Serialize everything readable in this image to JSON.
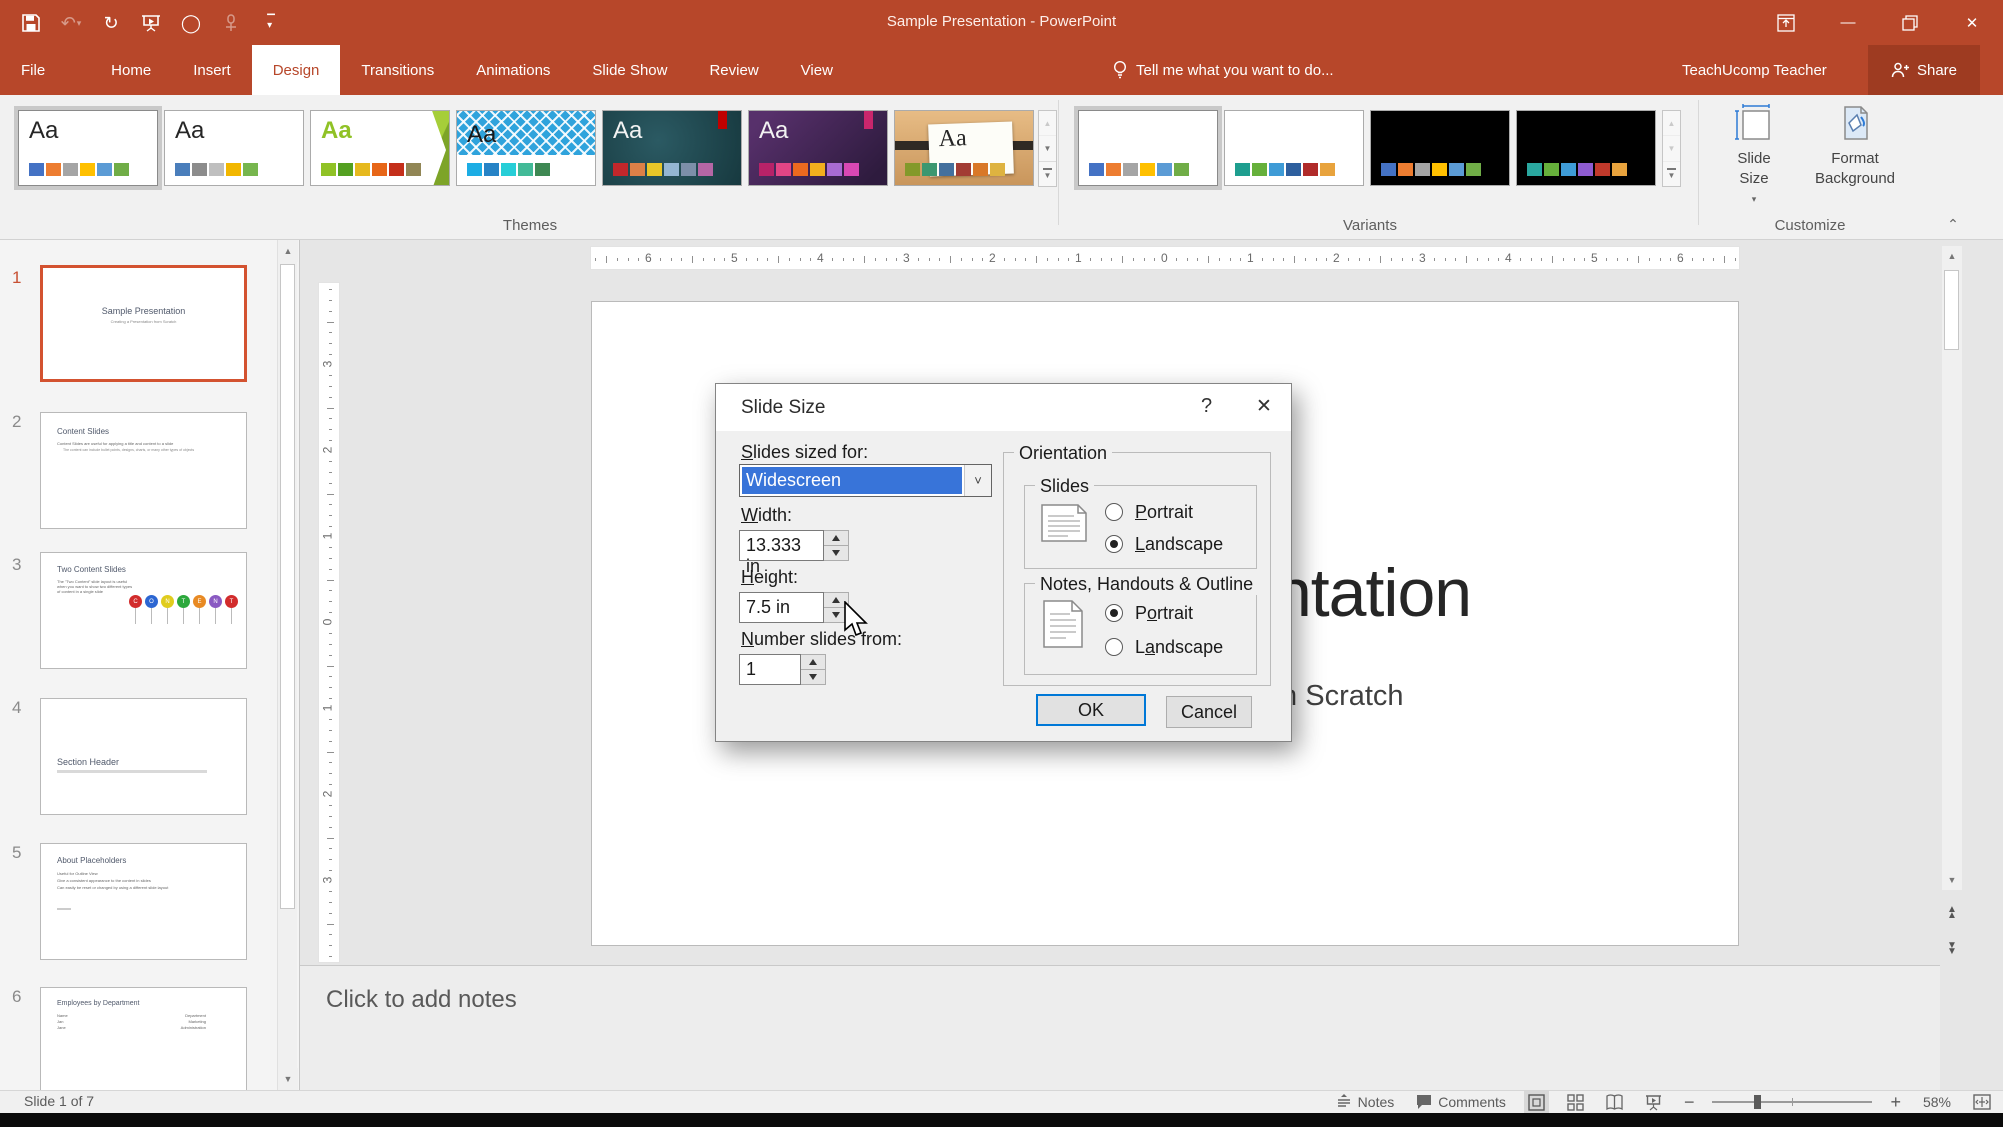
{
  "titlebar": {
    "title": "Sample Presentation - PowerPoint"
  },
  "tabs": [
    {
      "label": "File"
    },
    {
      "label": "Home"
    },
    {
      "label": "Insert"
    },
    {
      "label": "Design",
      "active": true
    },
    {
      "label": "Transitions"
    },
    {
      "label": "Animations"
    },
    {
      "label": "Slide Show"
    },
    {
      "label": "Review"
    },
    {
      "label": "View"
    }
  ],
  "tell_me": "Tell me what you want to do...",
  "account": "TeachUcomp Teacher",
  "share_label": "Share",
  "groups": {
    "themes": "Themes",
    "variants": "Variants",
    "customize": "Customize"
  },
  "customize": {
    "slide_size_label": "Slide Size",
    "format_background_label": "Format Background"
  },
  "themes": [
    {
      "letters": "Aa",
      "colors": [
        "#4472C4",
        "#ED7D31",
        "#A5A5A5",
        "#FFC000",
        "#5B9BD5",
        "#70AD47"
      ]
    },
    {
      "letters": "Aa",
      "colors": [
        "#4A7EBB",
        "#8C8C8C",
        "#BFBFBF",
        "#F2B700",
        "#77B64E"
      ]
    },
    {
      "letters": "Aa",
      "colors": [
        "#90C226",
        "#54A021",
        "#E6B91E",
        "#E76618",
        "#C42F1A",
        "#918655"
      ]
    },
    {
      "letters": "Aa",
      "colors": [
        "#1CADE4",
        "#2683C6",
        "#27CED7",
        "#42BA97",
        "#3E8853"
      ]
    },
    {
      "letters": "Aa",
      "colors": [
        "#C3272B",
        "#DD8047",
        "#E8C628",
        "#94B6D2",
        "#7D8FA9",
        "#B566A5"
      ]
    },
    {
      "letters": "Aa",
      "colors": [
        "#B72268",
        "#E34585",
        "#EC6A1F",
        "#F2AF1D",
        "#A86BD2",
        "#D948B4"
      ]
    },
    {
      "letters": "Aa",
      "colors": [
        "#83992A",
        "#3C9770",
        "#44709D",
        "#A23C33",
        "#D97828",
        "#DEB340"
      ]
    }
  ],
  "variants": [
    {
      "colors": [
        "#4472C4",
        "#ED7D31",
        "#A5A5A5",
        "#FFC000",
        "#5B9BD5",
        "#70AD47"
      ]
    },
    {
      "colors": [
        "#1E9E8F",
        "#66B03B",
        "#3E9BD6",
        "#2E5F9E",
        "#B02B2A",
        "#E8A33D"
      ]
    },
    {
      "colors": [
        "#4472C4",
        "#ED7D31",
        "#A5A5A5",
        "#FFC000",
        "#5B9BD5",
        "#70AD47"
      ],
      "dark": true
    },
    {
      "colors": [
        "#2AA8A0",
        "#66B03B",
        "#3E9BD6",
        "#8E5BD0",
        "#C0392B",
        "#E8A33D"
      ],
      "dark": true
    }
  ],
  "thumbnails": [
    {
      "num": "1",
      "title": "Sample Presentation",
      "subtitle": "Creating a Presentation from Scratch"
    },
    {
      "num": "2",
      "title": "Content Slides",
      "bullets": [
        "Content Slides are useful for applying a title and content to a slide",
        "The content can include bullet points, designs, charts, or many other types of objects"
      ]
    },
    {
      "num": "3",
      "title": "Two Content Slides",
      "bullets": [
        "The \"Two Content\" slide layout is useful when you want to show two different types of content in a single slide"
      ],
      "balloons": [
        {
          "letter": "C",
          "color": "#D22C2C"
        },
        {
          "letter": "O",
          "color": "#2C66D2"
        },
        {
          "letter": "N",
          "color": "#E0CC1E"
        },
        {
          "letter": "T",
          "color": "#2CA83C"
        },
        {
          "letter": "E",
          "color": "#E88A24"
        },
        {
          "letter": "N",
          "color": "#8A5AC2"
        },
        {
          "letter": "T",
          "color": "#D22C2C"
        }
      ]
    },
    {
      "num": "4",
      "title": "Section Header"
    },
    {
      "num": "5",
      "title": "About Placeholders",
      "bullets": [
        "Useful for Outline View",
        "Give a consistent appearance to the content in slides",
        "Can easily be reset or changed by using a different slide layout"
      ]
    },
    {
      "num": "6",
      "title": "Employees by Department",
      "table": {
        "col1": [
          "Name",
          "Jan",
          "Jane"
        ],
        "col2": [
          "Department",
          "Marketing",
          "Administration"
        ]
      }
    }
  ],
  "slide": {
    "title": "Sample Presentation",
    "subtitle": "Creating a Presentation from Scratch"
  },
  "notes_placeholder": "Click to add notes",
  "statusbar": {
    "counter": "Slide 1 of 7",
    "notes": "Notes",
    "comments": "Comments",
    "zoom_level": "58%"
  },
  "rulers": {
    "h": [
      "6",
      "5",
      "4",
      "3",
      "2",
      "1",
      "0",
      "1",
      "2",
      "3",
      "4",
      "5",
      "6"
    ],
    "v": [
      "3",
      "2",
      "1",
      "0",
      "1",
      "2",
      "3"
    ]
  },
  "dialog": {
    "title": "Slide Size",
    "help": "?",
    "close": "✕",
    "sized_for_label": {
      "text": "Slides sized for:",
      "u": 0
    },
    "sized_for_value": "Widescreen",
    "width_label": {
      "text": "Width:",
      "u": 0
    },
    "width_value": "13.333 in",
    "height_label": {
      "text": "Height:",
      "u": 0
    },
    "height_value": "7.5 in",
    "number_label": {
      "text": "Number slides from:",
      "u": 0
    },
    "number_value": "1",
    "orientation_label": "Orientation",
    "slides_group_label": "Slides",
    "notes_group_label": "Notes, Handouts & Outline",
    "slides_portrait": {
      "text": "Portrait",
      "u": 0
    },
    "slides_landscape": {
      "text": "Landscape",
      "u": 0
    },
    "notes_portrait": {
      "text": "Portrait",
      "u": 1
    },
    "notes_landscape": {
      "text": "Landscape",
      "u": 1
    },
    "slides_orientation": "landscape",
    "notes_orientation": "portrait",
    "ok": "OK",
    "cancel": "Cancel"
  },
  "colors": {
    "brand_red": "#B7472A",
    "selection_blue": "#3874D9",
    "focus_blue": "#0078D7",
    "thumb_selected_border": "#D35230"
  }
}
